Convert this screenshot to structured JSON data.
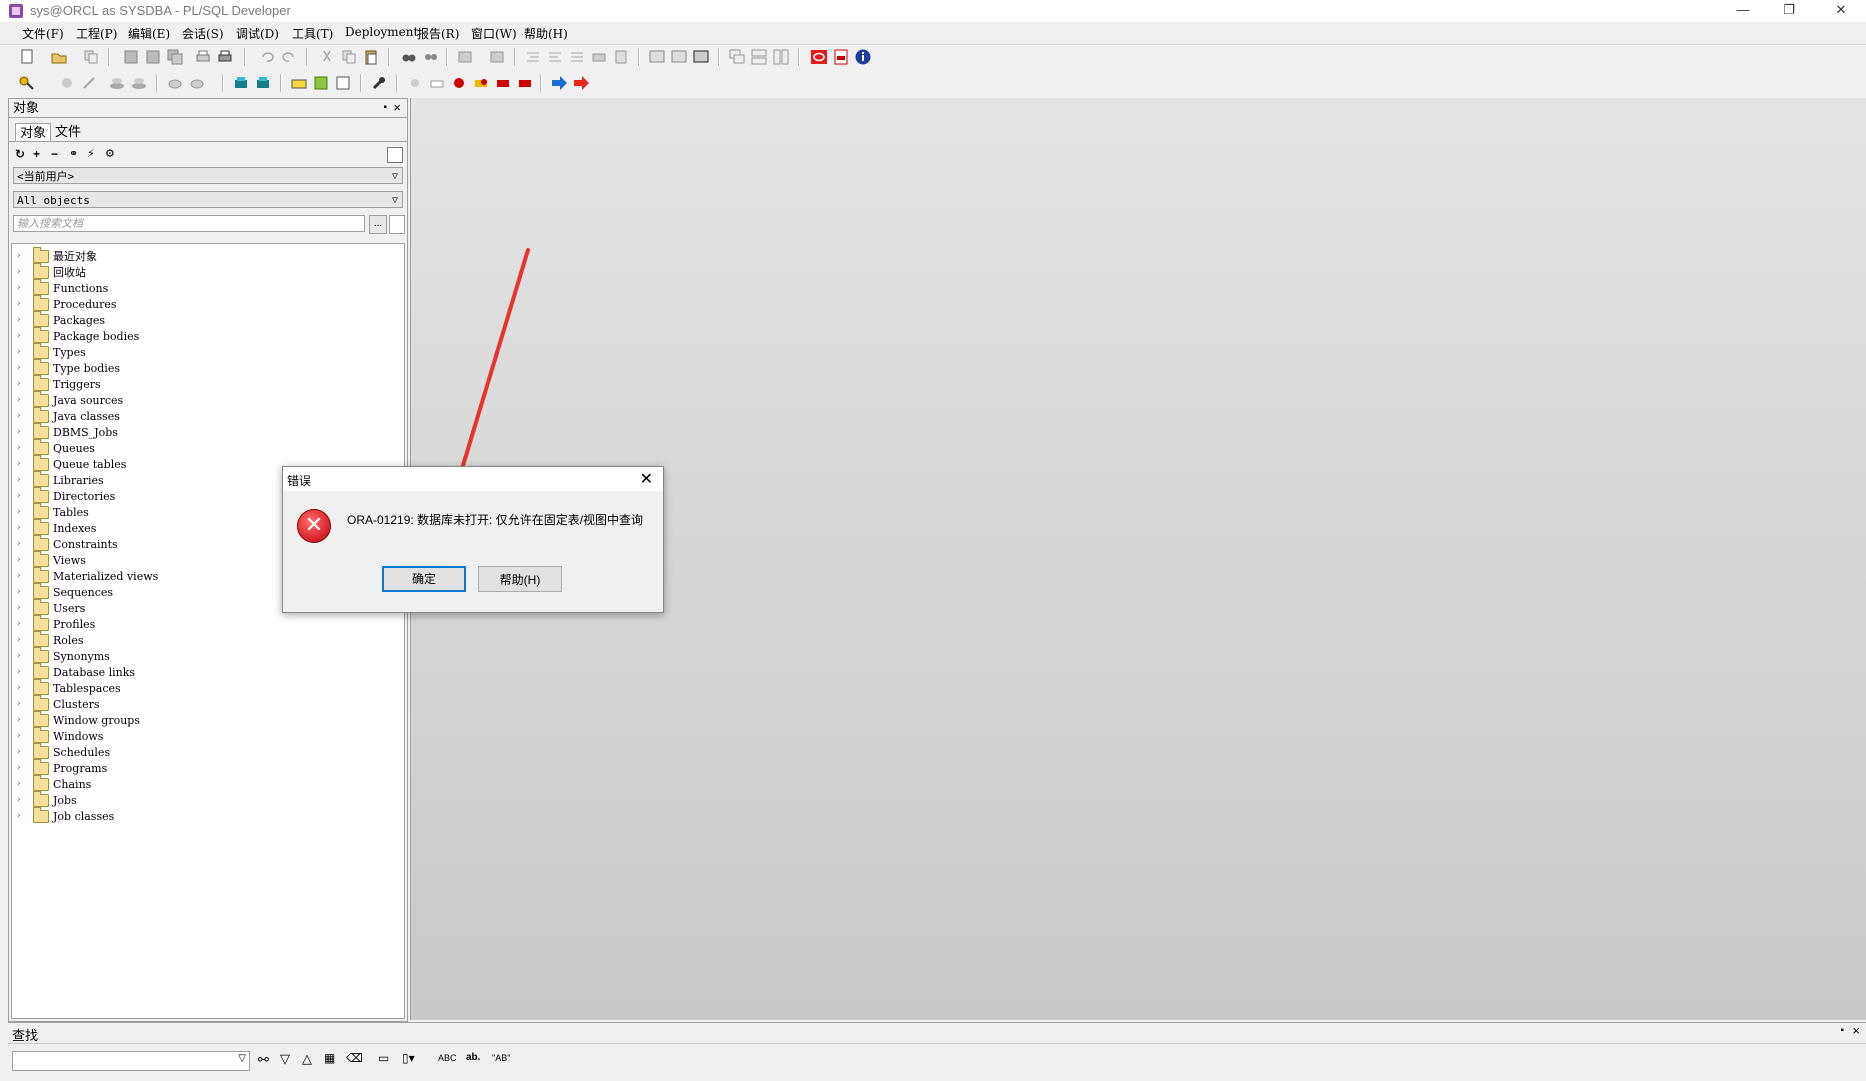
{
  "window": {
    "title": "sys@ORCL as SYSDBA - PL/SQL Developer",
    "minimize": "—",
    "restore": "❐",
    "close": "✕"
  },
  "menu": [
    "文件(F)",
    "工程(P)",
    "编辑(E)",
    "会话(S)",
    "调试(D)",
    "工具(T)",
    "Deployment",
    "报告(R)",
    "窗口(W)",
    "帮助(H)"
  ],
  "object_panel": {
    "header": "对象",
    "pin": "📌",
    "close": "×",
    "tabs": [
      "对象",
      "文件"
    ],
    "user_combo": "<当前用户>",
    "filter_combo": "All objects",
    "search_placeholder": "输入搜索文档",
    "search_button": "...",
    "tree_items": [
      "最近对象",
      "回收站",
      "Functions",
      "Procedures",
      "Packages",
      "Package bodies",
      "Types",
      "Type bodies",
      "Triggers",
      "Java sources",
      "Java classes",
      "DBMS_Jobs",
      "Queues",
      "Queue tables",
      "Libraries",
      "Directories",
      "Tables",
      "Indexes",
      "Constraints",
      "Views",
      "Materialized views",
      "Sequences",
      "Users",
      "Profiles",
      "Roles",
      "Synonyms",
      "Database links",
      "Tablespaces",
      "Clusters",
      "Window groups",
      "Windows",
      "Schedules",
      "Programs",
      "Chains",
      "Jobs",
      "Job classes"
    ]
  },
  "find_panel": {
    "header": "查找",
    "abc_label": "ABC",
    "ab_label": "\"AB\""
  },
  "dialog": {
    "title": "错误",
    "message": "ORA-01219: 数据库未打开: 仅允许在固定表/视图中查询",
    "ok_label": "确定",
    "help_label": "帮助(H)"
  },
  "colors": {
    "arrow": "#e8322c",
    "default_button_border": "#0078d7",
    "error_icon": "#c0000b"
  }
}
